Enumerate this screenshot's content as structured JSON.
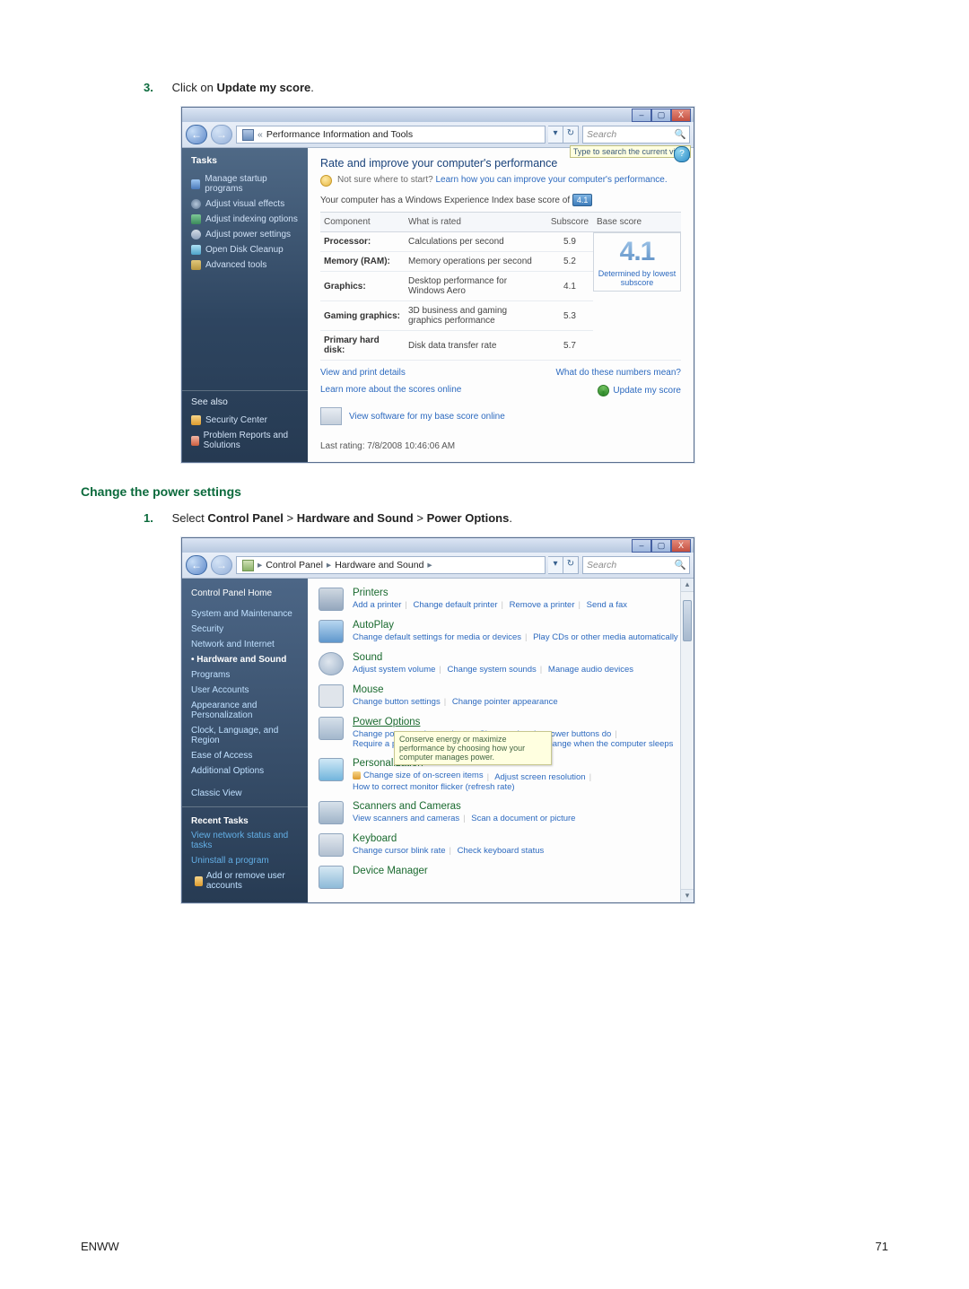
{
  "step3": {
    "num": "3.",
    "prefix": "Click on ",
    "bold": "Update my score",
    "suffix": "."
  },
  "section2": "Change the power settings",
  "step1": {
    "num": "1.",
    "prefix": "Select ",
    "b1": "Control Panel",
    "gt": " > ",
    "b2": "Hardware and Sound",
    "b3": "Power Options",
    "suffix": "."
  },
  "footer": {
    "left": "ENWW",
    "right": "71"
  },
  "win1": {
    "buttons": {
      "min": "–",
      "max": "▢",
      "close": "X"
    },
    "nav": {
      "back": "←",
      "fwd": "→"
    },
    "crumb": {
      "chev": "«",
      "label": "Performance Information and Tools"
    },
    "crumbCtrl": {
      "drop": "▾",
      "refresh": "↻"
    },
    "search": {
      "placeholder": "Search",
      "mag": "🔍",
      "tip": "Type to search the current view."
    },
    "tasksHdr": "Tasks",
    "tasks": [
      "Manage startup programs",
      "Adjust visual effects",
      "Adjust indexing options",
      "Adjust power settings",
      "Open Disk Cleanup",
      "Advanced tools"
    ],
    "seeAlsoHdr": "See also",
    "seeAlso": [
      "Security Center",
      "Problem Reports and Solutions"
    ],
    "paneTitle": "Rate and improve your computer's performance",
    "hint": {
      "pre": "Not sure where to start?  ",
      "link": "Learn how you can improve your computer's performance."
    },
    "baseLine": {
      "pre": "Your computer has a Windows Experience Index base score of  ",
      "badge": "4.1"
    },
    "th": {
      "c0": "Component",
      "c1": "What is rated",
      "c2": "Subscore",
      "c3": "Base score"
    },
    "rows": [
      {
        "c0": "Processor:",
        "c1": "Calculations per second",
        "c2": "5.9"
      },
      {
        "c0": "Memory (RAM):",
        "c1": "Memory operations per second",
        "c2": "5.2"
      },
      {
        "c0": "Graphics:",
        "c1": "Desktop performance for Windows Aero",
        "c2": "4.1"
      },
      {
        "c0": "Gaming graphics:",
        "c1": "3D business and gaming graphics performance",
        "c2": "5.3"
      },
      {
        "c0": "Primary hard disk:",
        "c1": "Disk data transfer rate",
        "c2": "5.7"
      }
    ],
    "big": {
      "num": "4.1",
      "cap": "Determined by lowest subscore"
    },
    "links1": {
      "l": "View and print details",
      "r": "What do these numbers mean?"
    },
    "links2": {
      "l": "Learn more about the scores online",
      "r": "Update my score"
    },
    "soft": "View software for my base score online",
    "last": "Last rating: 7/8/2008 10:46:06 AM"
  },
  "win2": {
    "crumb": {
      "root": "",
      "p1": "Control Panel",
      "p2": "Hardware and Sound",
      "sep": "▸"
    },
    "search": {
      "placeholder": "Search",
      "mag": "🔍"
    },
    "side": {
      "home": "Control Panel Home",
      "items": [
        "System and Maintenance",
        "Security",
        "Network and Internet",
        "Hardware and Sound",
        "Programs",
        "User Accounts",
        "Appearance and Personalization",
        "Clock, Language, and Region",
        "Ease of Access",
        "Additional Options"
      ],
      "classic": "Classic View",
      "recentHdr": "Recent Tasks",
      "recent": [
        "View network status and tasks",
        "Uninstall a program",
        "Add or remove user accounts"
      ]
    },
    "cats": {
      "printers": {
        "title": "Printers",
        "subs": [
          "Add a printer",
          "Change default printer",
          "Remove a printer",
          "Send a fax"
        ]
      },
      "autoplay": {
        "title": "AutoPlay",
        "subs": [
          "Change default settings for media or devices",
          "Play CDs or other media automatically"
        ]
      },
      "sound": {
        "title": "Sound",
        "subs": [
          "Adjust system volume",
          "Change system sounds",
          "Manage audio devices"
        ]
      },
      "mouse": {
        "title": "Mouse",
        "subs": [
          "Change button settings",
          "Change pointer appearance"
        ]
      },
      "power": {
        "title": "Power Options",
        "line1": [
          "Change power-saving settings",
          "Change what the power buttons do"
        ],
        "line2": [
          "Require a password when the computer wakes",
          "Change when the computer sleeps"
        ]
      },
      "personal": {
        "title": "Personalization",
        "subs": [
          "Change size of on-screen items",
          "Adjust screen resolution",
          "How to correct monitor flicker (refresh rate)"
        ]
      },
      "scanner": {
        "title": "Scanners and Cameras",
        "subs": [
          "View scanners and cameras",
          "Scan a document or picture"
        ]
      },
      "keyboard": {
        "title": "Keyboard",
        "subs": [
          "Change cursor blink rate",
          "Check keyboard status"
        ]
      },
      "devmgr": {
        "title": "Device Manager"
      }
    },
    "tooltip": "Conserve energy or maximize performance by choosing how your computer manages power."
  }
}
